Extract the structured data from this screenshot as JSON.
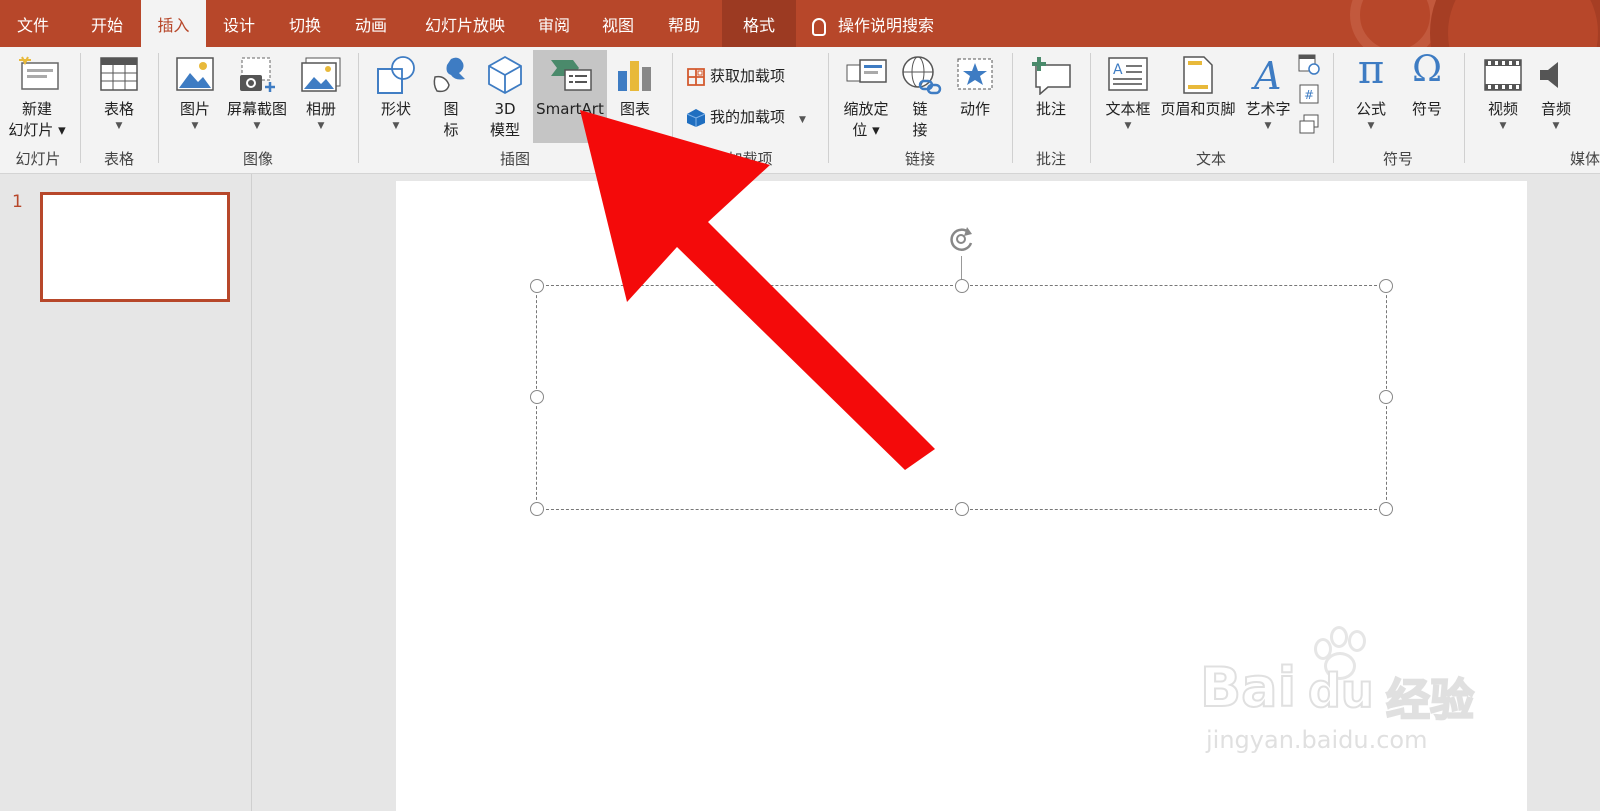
{
  "tabs": [
    {
      "label": "文件"
    },
    {
      "label": "开始"
    },
    {
      "label": "插入"
    },
    {
      "label": "设计"
    },
    {
      "label": "切换"
    },
    {
      "label": "动画"
    },
    {
      "label": "幻灯片放映"
    },
    {
      "label": "审阅"
    },
    {
      "label": "视图"
    },
    {
      "label": "帮助"
    },
    {
      "label": "格式"
    }
  ],
  "search": {
    "label": "操作说明搜索"
  },
  "ribbon": {
    "new_slide": {
      "label1": "新建",
      "label2": "幻灯片"
    },
    "table": {
      "label": "表格"
    },
    "picture": {
      "label": "图片"
    },
    "screenshot": {
      "label": "屏幕截图"
    },
    "album": {
      "label": "相册"
    },
    "shapes": {
      "label": "形状"
    },
    "icons": {
      "label1": "图",
      "label2": "标"
    },
    "model3d": {
      "label1": "3D",
      "label2": "模型"
    },
    "smartart": {
      "label": "SmartArt"
    },
    "chart": {
      "label": "图表"
    },
    "get_addins": {
      "label": "获取加载项"
    },
    "my_addins": {
      "label": "我的加载项"
    },
    "zoom": {
      "label1": "缩放定",
      "label2": "位"
    },
    "link": {
      "label1": "链",
      "label2": "接"
    },
    "action": {
      "label": "动作"
    },
    "comment": {
      "label": "批注"
    },
    "textbox": {
      "label": "文本框"
    },
    "header_footer": {
      "label": "页眉和页脚"
    },
    "wordart": {
      "label": "艺术字"
    },
    "equation": {
      "label": "公式"
    },
    "symbol": {
      "label": "符号"
    },
    "video": {
      "label": "视频"
    },
    "audio": {
      "label": "音频"
    },
    "groups": {
      "slides": "幻灯片",
      "tables": "表格",
      "images": "图像",
      "illustrations": "插图",
      "addins": "加载项",
      "links": "链接",
      "comments": "批注",
      "text": "文本",
      "symbols": "符号",
      "media": "媒体"
    }
  },
  "thumbnails": [
    {
      "number": "1"
    }
  ],
  "watermark": {
    "brand": "Bai",
    "du": "du",
    "jingyan": "经验",
    "url": "jingyan.baidu.com"
  },
  "colors": {
    "accent": "#b7472a",
    "arrow": "#f40a0a"
  }
}
